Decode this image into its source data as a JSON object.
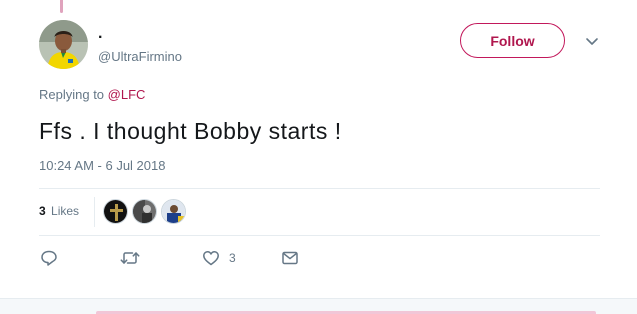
{
  "user": {
    "display_name": ".",
    "screen_name": "@UltraFirmino"
  },
  "follow_button": {
    "label": "Follow"
  },
  "reply": {
    "prefix": "Replying to ",
    "mention": "@LFC"
  },
  "tweet": {
    "text": "Ffs . I thought Bobby starts !",
    "timestamp": "10:24 AM - 6 Jul 2018"
  },
  "stats": {
    "likes_count": "3",
    "likes_label": "Likes"
  },
  "actions": {
    "reply_icon": "reply-icon",
    "retweet_icon": "retweet-icon",
    "like_icon": "heart-icon",
    "like_count": "3",
    "dm_icon": "mail-icon"
  },
  "colors": {
    "accent": "#b0174e",
    "muted": "#657786",
    "text": "#14171a",
    "divider": "#e6ecf0"
  }
}
